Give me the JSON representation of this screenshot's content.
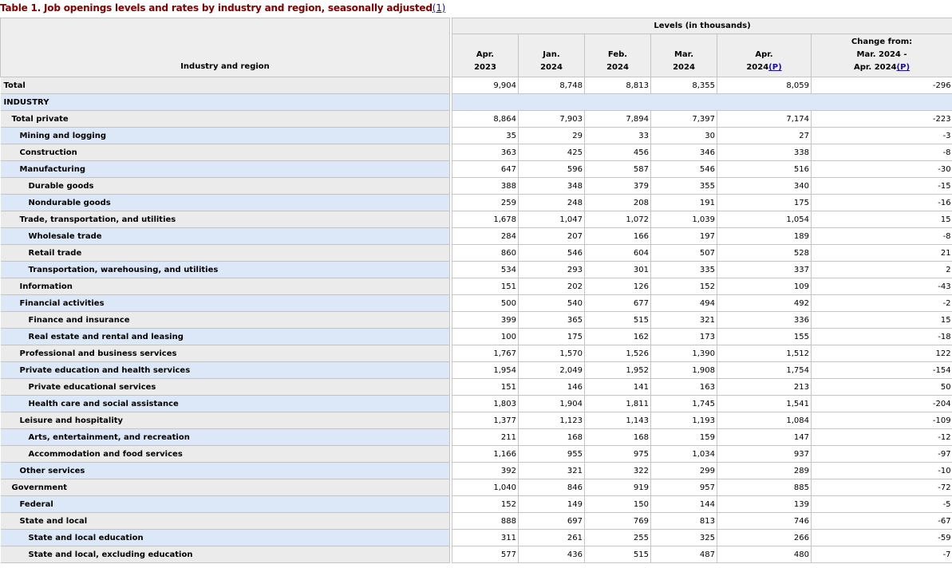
{
  "caption": {
    "title": "Table 1. Job openings levels and rates by industry and region, seasonally adjusted",
    "footnote": "(1)"
  },
  "header": {
    "stub": "Industry and region",
    "super": "Levels (in thousands)",
    "cols": [
      {
        "line1": "Apr.",
        "line2": "2023",
        "note": ""
      },
      {
        "line1": "Jan.",
        "line2": "2024",
        "note": ""
      },
      {
        "line1": "Feb.",
        "line2": "2024",
        "note": ""
      },
      {
        "line1": "Mar.",
        "line2": "2024",
        "note": ""
      },
      {
        "line1": "Apr.",
        "line2": "2024",
        "note": "(P)"
      }
    ],
    "change": {
      "line1": "Change from:",
      "line2": "Mar. 2024 -",
      "line3": "Apr. 2024",
      "note": "(P)"
    }
  },
  "rows": [
    {
      "label": "Total",
      "level": 0,
      "values": [
        "9,904",
        "8,748",
        "8,813",
        "8,355",
        "8,059",
        "-296"
      ]
    },
    {
      "label": "INDUSTRY",
      "level": 0,
      "section": true,
      "values": []
    },
    {
      "label": "Total private",
      "level": 1,
      "values": [
        "8,864",
        "7,903",
        "7,894",
        "7,397",
        "7,174",
        "-223"
      ]
    },
    {
      "label": "Mining and logging",
      "level": 2,
      "values": [
        "35",
        "29",
        "33",
        "30",
        "27",
        "-3"
      ]
    },
    {
      "label": "Construction",
      "level": 2,
      "values": [
        "363",
        "425",
        "456",
        "346",
        "338",
        "-8"
      ]
    },
    {
      "label": "Manufacturing",
      "level": 2,
      "values": [
        "647",
        "596",
        "587",
        "546",
        "516",
        "-30"
      ]
    },
    {
      "label": "Durable goods",
      "level": 3,
      "values": [
        "388",
        "348",
        "379",
        "355",
        "340",
        "-15"
      ]
    },
    {
      "label": "Nondurable goods",
      "level": 3,
      "values": [
        "259",
        "248",
        "208",
        "191",
        "175",
        "-16"
      ]
    },
    {
      "label": "Trade, transportation, and utilities",
      "level": 2,
      "values": [
        "1,678",
        "1,047",
        "1,072",
        "1,039",
        "1,054",
        "15"
      ]
    },
    {
      "label": "Wholesale trade",
      "level": 3,
      "values": [
        "284",
        "207",
        "166",
        "197",
        "189",
        "-8"
      ]
    },
    {
      "label": "Retail trade",
      "level": 3,
      "values": [
        "860",
        "546",
        "604",
        "507",
        "528",
        "21"
      ]
    },
    {
      "label": "Transportation, warehousing, and utilities",
      "level": 3,
      "values": [
        "534",
        "293",
        "301",
        "335",
        "337",
        "2"
      ]
    },
    {
      "label": "Information",
      "level": 2,
      "values": [
        "151",
        "202",
        "126",
        "152",
        "109",
        "-43"
      ]
    },
    {
      "label": "Financial activities",
      "level": 2,
      "values": [
        "500",
        "540",
        "677",
        "494",
        "492",
        "-2"
      ]
    },
    {
      "label": "Finance and insurance",
      "level": 3,
      "values": [
        "399",
        "365",
        "515",
        "321",
        "336",
        "15"
      ]
    },
    {
      "label": "Real estate and rental and leasing",
      "level": 3,
      "values": [
        "100",
        "175",
        "162",
        "173",
        "155",
        "-18"
      ]
    },
    {
      "label": "Professional and business services",
      "level": 2,
      "values": [
        "1,767",
        "1,570",
        "1,526",
        "1,390",
        "1,512",
        "122"
      ]
    },
    {
      "label": "Private education and health services",
      "level": 2,
      "values": [
        "1,954",
        "2,049",
        "1,952",
        "1,908",
        "1,754",
        "-154"
      ]
    },
    {
      "label": "Private educational services",
      "level": 3,
      "values": [
        "151",
        "146",
        "141",
        "163",
        "213",
        "50"
      ]
    },
    {
      "label": "Health care and social assistance",
      "level": 3,
      "values": [
        "1,803",
        "1,904",
        "1,811",
        "1,745",
        "1,541",
        "-204"
      ]
    },
    {
      "label": "Leisure and hospitality",
      "level": 2,
      "values": [
        "1,377",
        "1,123",
        "1,143",
        "1,193",
        "1,084",
        "-109"
      ]
    },
    {
      "label": "Arts, entertainment, and recreation",
      "level": 3,
      "values": [
        "211",
        "168",
        "168",
        "159",
        "147",
        "-12"
      ]
    },
    {
      "label": "Accommodation and food services",
      "level": 3,
      "values": [
        "1,166",
        "955",
        "975",
        "1,034",
        "937",
        "-97"
      ]
    },
    {
      "label": "Other services",
      "level": 2,
      "values": [
        "392",
        "321",
        "322",
        "299",
        "289",
        "-10"
      ]
    },
    {
      "label": "Government",
      "level": 1,
      "values": [
        "1,040",
        "846",
        "919",
        "957",
        "885",
        "-72"
      ]
    },
    {
      "label": "Federal",
      "level": 2,
      "values": [
        "152",
        "149",
        "150",
        "144",
        "139",
        "-5"
      ]
    },
    {
      "label": "State and local",
      "level": 2,
      "values": [
        "888",
        "697",
        "769",
        "813",
        "746",
        "-67"
      ]
    },
    {
      "label": "State and local education",
      "level": 3,
      "values": [
        "311",
        "261",
        "255",
        "325",
        "266",
        "-59"
      ]
    },
    {
      "label": "State and local, excluding education",
      "level": 3,
      "values": [
        "577",
        "436",
        "515",
        "487",
        "480",
        "-7"
      ]
    }
  ]
}
